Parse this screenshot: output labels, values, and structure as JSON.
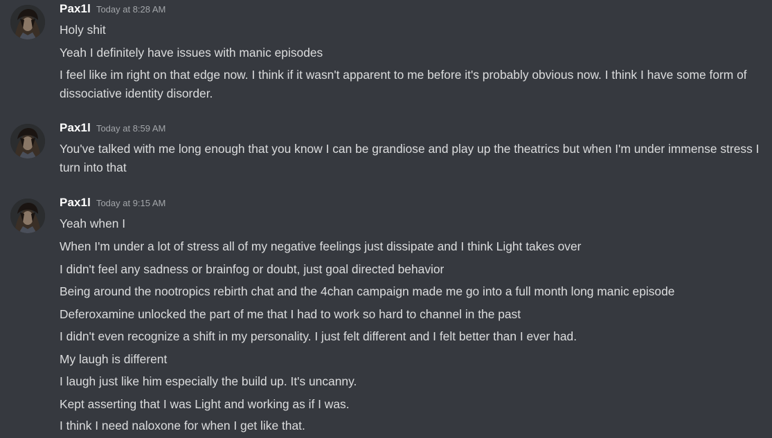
{
  "messages": [
    {
      "author": "Pax1l",
      "timestamp": "Today at 8:28 AM",
      "lines": [
        "Holy shit",
        "Yeah I definitely have issues with manic episodes",
        "I feel like im right on that edge now. I think if it wasn't apparent to me before it's probably obvious now. I think I have some form of dissociative identity disorder."
      ]
    },
    {
      "author": "Pax1l",
      "timestamp": "Today at 8:59 AM",
      "lines": [
        "You've talked with me long enough that you know I can be grandiose and play up the theatrics but when I'm under immense stress I turn into that"
      ]
    },
    {
      "author": "Pax1l",
      "timestamp": "Today at 9:15 AM",
      "lines": [
        "Yeah when I",
        "When I'm under a lot of stress all of my negative feelings just dissipate and I think Light takes over",
        "I didn't feel any sadness or brainfog or doubt, just goal directed behavior",
        "Being around the nootropics rebirth chat and the 4chan campaign made me go into a full month long manic episode",
        "Deferoxamine unlocked the part of me that I had to work so hard to channel in the past",
        "I didn't even recognize a shift in my personality. I just felt different and I felt better than I ever had.",
        "My laugh is different",
        "I laugh just like him especially the build up. It's uncanny.",
        "Kept asserting that I was Light and working as if I was.",
        "I think I need naloxone for when I get like that."
      ]
    }
  ]
}
